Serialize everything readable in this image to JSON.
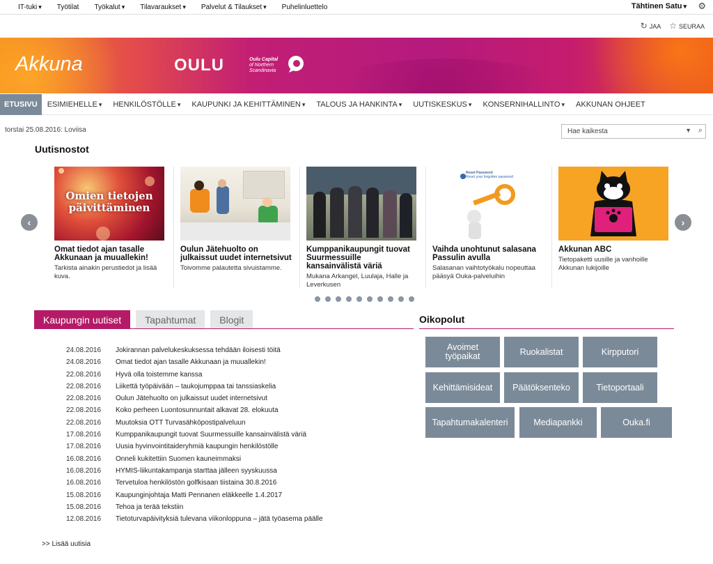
{
  "suitebar": {
    "menu": [
      "IT-tuki",
      "Työtilat",
      "Työkalut",
      "Tilavaraukset",
      "Palvelut & Tilaukset",
      "Puhelinluettelo"
    ],
    "menu_has_dropdown": [
      true,
      false,
      true,
      true,
      true,
      false
    ],
    "user": "Tähtinen Satu",
    "gear_icon": "gear-icon"
  },
  "sharebar": {
    "share": "JAA",
    "follow": "SEURAA"
  },
  "banner": {
    "logo": "Akkuna",
    "city": "OULU",
    "capital_line1": "Oulu Capital",
    "capital_line2": "of Northern",
    "capital_line3": "Scandinavia"
  },
  "nav": {
    "items": [
      "ETUSIVU",
      "ESIMIEHELLE",
      "HENKILÖSTÖLLE",
      "KAUPUNKI JA KEHITTÄMINEN",
      "TALOUS JA HANKINTA",
      "UUTISKESKUS",
      "KONSERNIHALLINTO",
      "AKKUNAN OHJEET"
    ],
    "dropdown": [
      false,
      true,
      true,
      true,
      true,
      true,
      true,
      false
    ]
  },
  "date_line": "torstai 25.08.2016: Loviisa",
  "search": {
    "placeholder": "Hae kaikesta"
  },
  "highlights": {
    "title": "Uutisnostot",
    "cards": [
      {
        "title": "Omat tiedot ajan tasalle Akkunaan ja muuallekin!",
        "desc": "Tarkista ainakin perustiedot ja lisää kuva.",
        "img_text1": "Omien tietojen",
        "img_text2": "päivittäminen"
      },
      {
        "title": "Oulun Jätehuolto on julkaissut uudet internetsivut",
        "desc": "Toivomme palautetta sivuistamme."
      },
      {
        "title": "Kumppanikaupungit tuovat Suurmessuille kansainvälistä väriä",
        "desc": "Mukana Arkangel, Luulaja, Halle ja Leverkusen"
      },
      {
        "title": "Vaihda unohtunut salasana Passulin avulla",
        "desc": "Salasanan vaihtotyökalu nopeuttaa pääsyä Ouka-palveluihin",
        "img_text1": "Reset Password",
        "img_text2": "Reset your forgotten password"
      },
      {
        "title": "Akkunan ABC",
        "desc": "Tietopaketti uusille ja vanhoille Akkunan lukijoille"
      }
    ],
    "dot_count": 10
  },
  "tabs": [
    "Kaupungin uutiset",
    "Tapahtumat",
    "Blogit"
  ],
  "news": [
    {
      "date": "24.08.2016",
      "title": "Jokirannan palvelukeskuksessa tehdään iloisesti töitä"
    },
    {
      "date": "24.08.2016",
      "title": "Omat tiedot ajan tasalle Akkunaan ja muuallekin!"
    },
    {
      "date": "22.08.2016",
      "title": "Hyvä olla toistemme kanssa"
    },
    {
      "date": "22.08.2016",
      "title": "Liikettä työpäivään – taukojumppaa tai tanssiaskelia"
    },
    {
      "date": "22.08.2016",
      "title": "Oulun Jätehuolto on julkaissut uudet internetsivut"
    },
    {
      "date": "22.08.2016",
      "title": "Koko perheen Luontosunnuntait alkavat 28. elokuuta"
    },
    {
      "date": "22.08.2016",
      "title": "Muutoksia OTT Turvasähköpostipalveluun"
    },
    {
      "date": "17.08.2016",
      "title": "Kumppanikaupungit tuovat Suurmessuille kansainvälistä väriä"
    },
    {
      "date": "17.08.2016",
      "title": "Uusia hyvinvointitaideryhmiä kaupungin henkilöstölle"
    },
    {
      "date": "16.08.2016",
      "title": "Onneli kukitettiin Suomen kauneimmaksi"
    },
    {
      "date": "16.08.2016",
      "title": "HYMIS-liikuntakampanja starttaa jälleen syyskuussa"
    },
    {
      "date": "16.08.2016",
      "title": "Tervetuloa henkilöstön golfkisaan tiistaina 30.8.2016"
    },
    {
      "date": "15.08.2016",
      "title": "Kaupunginjohtaja Matti Pennanen eläkkeelle 1.4.2017"
    },
    {
      "date": "15.08.2016",
      "title": "Tehoa ja terää tekstiin"
    },
    {
      "date": "12.08.2016",
      "title": "Tietoturvapäivityksiä tulevana viikonloppuna – jätä työasema päälle"
    }
  ],
  "more_news": ">> Lisää uutisia",
  "shortcuts": {
    "title": "Oikopolut",
    "rows": [
      [
        "Avoimet työpaikat",
        "Ruokalistat",
        "Kirpputori"
      ],
      [
        "Kehittämisideat",
        "Päätöksenteko",
        "Tietoportaali"
      ],
      [
        "Tapahtumakalenteri",
        "Mediapankki",
        "Ouka.fi"
      ]
    ]
  },
  "colors": {
    "accent": "#b51a68",
    "tile": "#7b8a98",
    "nav_active": "#7b8a98"
  }
}
